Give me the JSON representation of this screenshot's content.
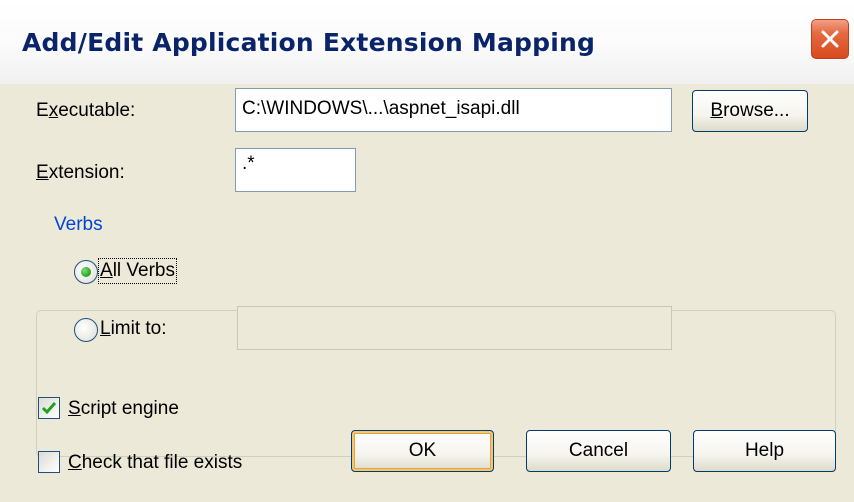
{
  "window": {
    "title": "Add/Edit Application Extension Mapping",
    "close_icon": "close-icon",
    "accent_color": "#0a246a",
    "close_color": "#d9481e"
  },
  "executable": {
    "label_mnemonic": "x",
    "label_pre": "E",
    "label_post": "ecutable:",
    "value": "C:\\WINDOWS\\...\\aspnet_isapi.dll",
    "browse_mnemonic": "B",
    "browse_rest": "rowse..."
  },
  "extension": {
    "label_mnemonic": "E",
    "label_rest": "xtension:",
    "value": ".*"
  },
  "verbs": {
    "group_label": "Verbs",
    "all_verbs_mnemonic": "A",
    "all_verbs_rest": "ll Verbs",
    "all_verbs_selected": true,
    "limit_to_mnemonic": "L",
    "limit_to_rest": "imit to:",
    "limit_to_selected": false,
    "limit_to_value": ""
  },
  "options": {
    "script_engine_mnemonic": "S",
    "script_engine_rest": "cript engine",
    "script_engine_checked": true,
    "check_file_mnemonic": "C",
    "check_file_rest": "heck that file exists",
    "check_file_checked": false
  },
  "buttons": {
    "ok": "OK",
    "cancel": "Cancel",
    "help": "Help"
  }
}
